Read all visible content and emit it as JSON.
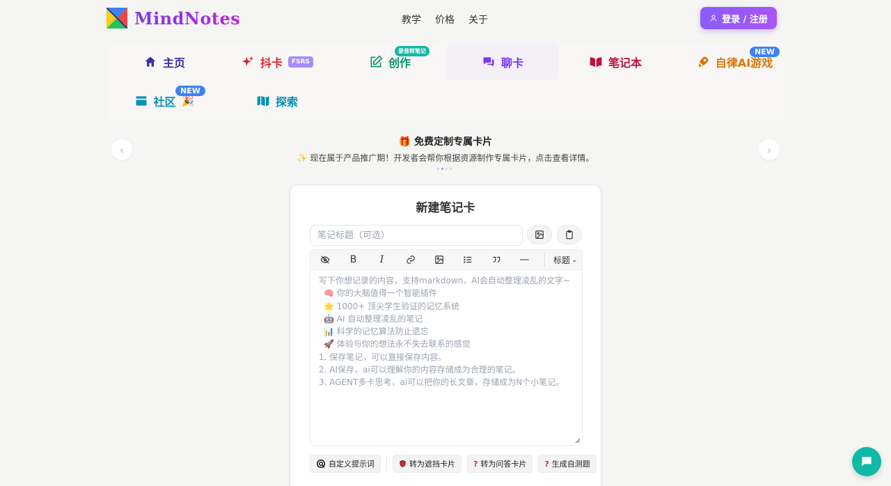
{
  "brand": {
    "name": "MindNotes",
    "accent": "#7c3aed"
  },
  "topnav": {
    "items": [
      "教学",
      "价格",
      "关于"
    ]
  },
  "login": {
    "label": "登录 / 注册"
  },
  "tabs": {
    "home": "主页",
    "doucard": "抖卡",
    "doucard_badge": "FSRS",
    "create": "创作",
    "create_badge": "录音转笔记",
    "chat": "聊卡",
    "notebook": "笔记本",
    "aigame": "自律AI游戏",
    "aigame_badge": "NEW",
    "community": "社区",
    "community_badge": "NEW",
    "explore": "探索"
  },
  "banner": {
    "title": "免费定制专属卡片",
    "subtitle": "现在属于产品推广期！开发者会帮你根据资源制作专属卡片，点击查看详情。"
  },
  "card": {
    "title": "新建笔记卡",
    "title_placeholder": "笔记标题（可选）",
    "heading_select": "标题",
    "editor_lines": [
      "写下你想记录的内容，支持markdown，AI会自动整理凌乱的文字~",
      "🧠 你的大脑值得一个智能插件",
      "🌟 1000+ 顶尖学生验证的记忆系统",
      "🤖 AI 自动整理凌乱的笔记",
      "📊 科学的记忆算法防止遗忘",
      "🚀 体验与你的想法永不失去联系的感觉",
      "1. 保存笔记，可以直接保存内容。",
      "2. AI保存，ai可以理解你的内容存储成为合理的笔记。",
      "3. AGENT多卡思考，ai可以把你的长文章，存储成为N个小笔记。"
    ],
    "actions": {
      "custom_prompt": "自定义提示词",
      "to_cloze": "转为遮挡卡片",
      "to_qa": "转为问答卡片",
      "gen_quiz": "生成自测题"
    }
  }
}
